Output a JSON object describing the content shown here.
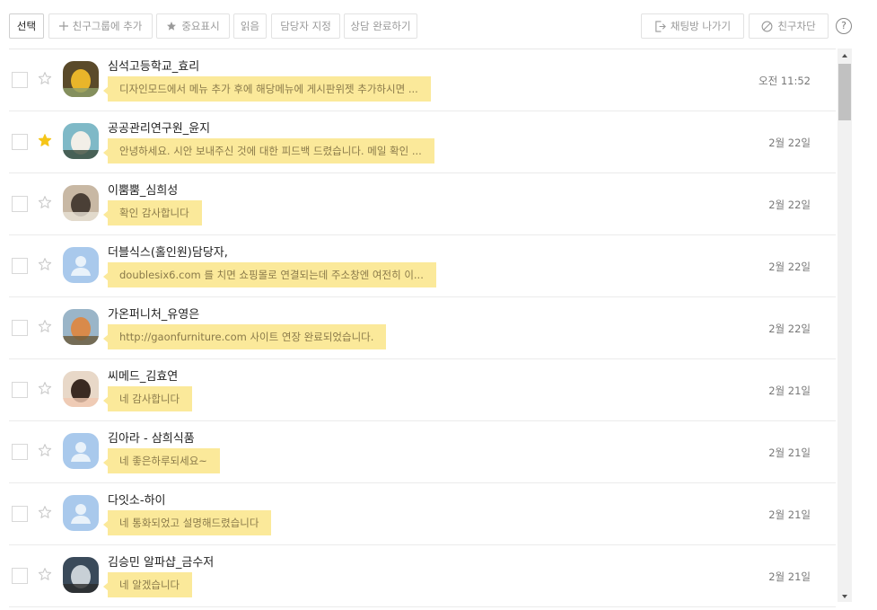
{
  "toolbar": {
    "select_label": "선택",
    "add_group_label": "친구그룹에 추가",
    "important_label": "중요표시",
    "read_label": "읽음",
    "assign_label": "담당자 지정",
    "complete_label": "상담 완료하기",
    "leave_label": "채팅방 나가기",
    "block_label": "친구차단",
    "help_label": "?"
  },
  "chats": [
    {
      "name": "심석고등학교_효리",
      "message": "디자인모드에서 메뉴 추가 후에 해당메뉴에 게시판위젯 추가하시면 ...",
      "time": "오전 11:52",
      "starred": false,
      "avatar": "photo-duck"
    },
    {
      "name": "공공관리연구원_윤지",
      "message": "안녕하세요. 시안 보내주신 것에 대한 피드백 드렸습니다. 메일 확인 ...",
      "time": "2월 22일",
      "starred": true,
      "avatar": "photo-person"
    },
    {
      "name": "이뿜뿜_심희성",
      "message": "확인 감사합니다",
      "time": "2월 22일",
      "starred": false,
      "avatar": "photo-people"
    },
    {
      "name": "더블식스(홀인원)담당자,",
      "message": "doublesix6.com 를 치면 쇼핑몰로 연결되는데 주소창엔 여전히 이...",
      "time": "2월 22일",
      "starred": false,
      "avatar": "default"
    },
    {
      "name": "가온퍼니처_유영은",
      "message": "http://gaonfurniture.com 사이트 연장 완료되었습니다.",
      "time": "2월 22일",
      "starred": false,
      "avatar": "photo-couple"
    },
    {
      "name": "씨메드_김효연",
      "message": "네 감사합니다",
      "time": "2월 21일",
      "starred": false,
      "avatar": "photo-woman"
    },
    {
      "name": "김아라 - 삼희식품",
      "message": "네 좋은하루되세요~",
      "time": "2월 21일",
      "starred": false,
      "avatar": "default"
    },
    {
      "name": "다잇소-하이",
      "message": "네 통화되었고 설명해드렸습니다",
      "time": "2월 21일",
      "starred": false,
      "avatar": "default"
    },
    {
      "name": "김승민 알파샵_금수저",
      "message": "네 알겠습니다",
      "time": "2월 21일",
      "starred": false,
      "avatar": "photo-street"
    }
  ],
  "colors": {
    "bubble": "#fbe99a",
    "bubble_text": "#8a7a4a",
    "star_active": "#f5c518",
    "star_inactive": "#c9c9c9",
    "default_avatar": "#a9c9ec"
  }
}
